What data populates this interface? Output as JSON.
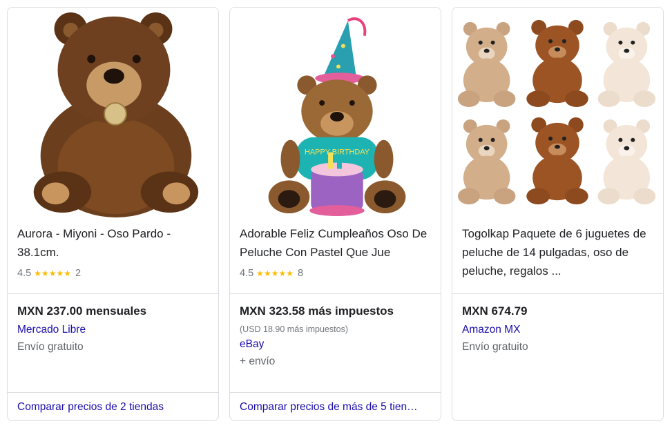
{
  "products": [
    {
      "title": "Aurora - Miyoni - Oso Pardo - 38.1cm.",
      "rating": "4.5",
      "stars": "★★★★★",
      "reviews": "2",
      "price": "MXN 237.00 mensuales",
      "store": "Mercado Libre",
      "shipping": "Envío gratuito",
      "compare": "Comparar precios de 2 tiendas",
      "image_icon": "brown-bear-plush-icon"
    },
    {
      "title": "Adorable Feliz Cumpleaños Oso De Peluche Con Pastel Que Jue",
      "rating": "4.5",
      "stars": "★★★★★",
      "reviews": "8",
      "price": "MXN 323.58 más impuestos",
      "price_secondary": "(USD 18.90 más impuestos)",
      "store": "eBay",
      "shipping": "+ envío",
      "compare": "Comparar precios de más de 5 tien…",
      "image_icon": "birthday-bear-plush-icon"
    },
    {
      "title": "Togolkap Paquete de 6 juguetes de peluche de 14 pulgadas, oso de peluche, regalos ...",
      "price": "MXN 674.79",
      "store": "Amazon MX",
      "shipping": "Envío gratuito",
      "image_icon": "six-teddy-bears-icon"
    }
  ],
  "colors": {
    "link": "#1a0dab",
    "star": "#fbbc04",
    "border": "#dadce0",
    "muted": "#70757a"
  }
}
